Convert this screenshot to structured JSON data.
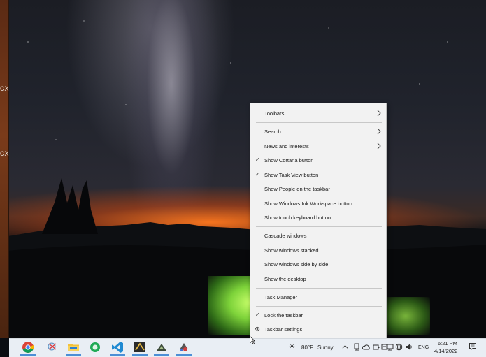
{
  "desktop": {
    "left_labels": [
      "CX",
      "CX"
    ]
  },
  "context_menu": {
    "items": [
      {
        "label": "Toolbars",
        "checked": false,
        "submenu": true
      },
      {
        "label": "Search",
        "checked": false,
        "submenu": true
      },
      {
        "label": "News and interests",
        "checked": false,
        "submenu": true
      },
      {
        "label": "Show Cortana button",
        "checked": true,
        "submenu": false
      },
      {
        "label": "Show Task View button",
        "checked": true,
        "submenu": false
      },
      {
        "label": "Show People on the taskbar",
        "checked": false,
        "submenu": false
      },
      {
        "label": "Show Windows Ink Workspace button",
        "checked": false,
        "submenu": false
      },
      {
        "label": "Show touch keyboard button",
        "checked": false,
        "submenu": false
      },
      {
        "label": "Cascade windows",
        "checked": false,
        "submenu": false
      },
      {
        "label": "Show windows stacked",
        "checked": false,
        "submenu": false
      },
      {
        "label": "Show windows side by side",
        "checked": false,
        "submenu": false
      },
      {
        "label": "Show the desktop",
        "checked": false,
        "submenu": false
      },
      {
        "label": "Task Manager",
        "checked": false,
        "submenu": false
      },
      {
        "label": "Lock the taskbar",
        "checked": true,
        "submenu": false
      },
      {
        "label": "Taskbar settings",
        "checked": false,
        "submenu": false,
        "icon": "gear-icon"
      }
    ],
    "check_glyph": "✓"
  },
  "taskbar": {
    "pinned_apps": [
      {
        "name": "chrome-icon"
      },
      {
        "name": "snipping-tool-icon"
      },
      {
        "name": "file-explorer-icon"
      },
      {
        "name": "green-app-icon"
      },
      {
        "name": "vscode-icon"
      },
      {
        "name": "terminal-app-icon"
      },
      {
        "name": "pen-app-icon"
      },
      {
        "name": "paint-app-icon"
      }
    ],
    "weather": {
      "temp": "80°F",
      "condition": "Sunny"
    },
    "language": "ENG",
    "time": "6:21 PM",
    "date": "4/14/2022"
  }
}
